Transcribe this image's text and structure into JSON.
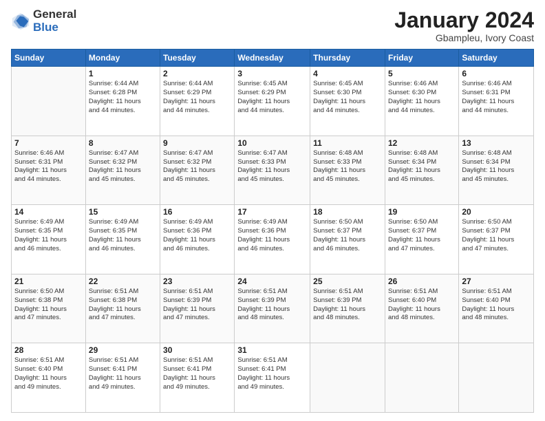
{
  "header": {
    "logo": {
      "general": "General",
      "blue": "Blue"
    },
    "title": "January 2024",
    "subtitle": "Gbampleu, Ivory Coast"
  },
  "calendar": {
    "days_of_week": [
      "Sunday",
      "Monday",
      "Tuesday",
      "Wednesday",
      "Thursday",
      "Friday",
      "Saturday"
    ],
    "weeks": [
      [
        {
          "num": "",
          "info": ""
        },
        {
          "num": "1",
          "info": "Sunrise: 6:44 AM\nSunset: 6:28 PM\nDaylight: 11 hours\nand 44 minutes."
        },
        {
          "num": "2",
          "info": "Sunrise: 6:44 AM\nSunset: 6:29 PM\nDaylight: 11 hours\nand 44 minutes."
        },
        {
          "num": "3",
          "info": "Sunrise: 6:45 AM\nSunset: 6:29 PM\nDaylight: 11 hours\nand 44 minutes."
        },
        {
          "num": "4",
          "info": "Sunrise: 6:45 AM\nSunset: 6:30 PM\nDaylight: 11 hours\nand 44 minutes."
        },
        {
          "num": "5",
          "info": "Sunrise: 6:46 AM\nSunset: 6:30 PM\nDaylight: 11 hours\nand 44 minutes."
        },
        {
          "num": "6",
          "info": "Sunrise: 6:46 AM\nSunset: 6:31 PM\nDaylight: 11 hours\nand 44 minutes."
        }
      ],
      [
        {
          "num": "7",
          "info": "Sunrise: 6:46 AM\nSunset: 6:31 PM\nDaylight: 11 hours\nand 44 minutes."
        },
        {
          "num": "8",
          "info": "Sunrise: 6:47 AM\nSunset: 6:32 PM\nDaylight: 11 hours\nand 45 minutes."
        },
        {
          "num": "9",
          "info": "Sunrise: 6:47 AM\nSunset: 6:32 PM\nDaylight: 11 hours\nand 45 minutes."
        },
        {
          "num": "10",
          "info": "Sunrise: 6:47 AM\nSunset: 6:33 PM\nDaylight: 11 hours\nand 45 minutes."
        },
        {
          "num": "11",
          "info": "Sunrise: 6:48 AM\nSunset: 6:33 PM\nDaylight: 11 hours\nand 45 minutes."
        },
        {
          "num": "12",
          "info": "Sunrise: 6:48 AM\nSunset: 6:34 PM\nDaylight: 11 hours\nand 45 minutes."
        },
        {
          "num": "13",
          "info": "Sunrise: 6:48 AM\nSunset: 6:34 PM\nDaylight: 11 hours\nand 45 minutes."
        }
      ],
      [
        {
          "num": "14",
          "info": "Sunrise: 6:49 AM\nSunset: 6:35 PM\nDaylight: 11 hours\nand 46 minutes."
        },
        {
          "num": "15",
          "info": "Sunrise: 6:49 AM\nSunset: 6:35 PM\nDaylight: 11 hours\nand 46 minutes."
        },
        {
          "num": "16",
          "info": "Sunrise: 6:49 AM\nSunset: 6:36 PM\nDaylight: 11 hours\nand 46 minutes."
        },
        {
          "num": "17",
          "info": "Sunrise: 6:49 AM\nSunset: 6:36 PM\nDaylight: 11 hours\nand 46 minutes."
        },
        {
          "num": "18",
          "info": "Sunrise: 6:50 AM\nSunset: 6:37 PM\nDaylight: 11 hours\nand 46 minutes."
        },
        {
          "num": "19",
          "info": "Sunrise: 6:50 AM\nSunset: 6:37 PM\nDaylight: 11 hours\nand 47 minutes."
        },
        {
          "num": "20",
          "info": "Sunrise: 6:50 AM\nSunset: 6:37 PM\nDaylight: 11 hours\nand 47 minutes."
        }
      ],
      [
        {
          "num": "21",
          "info": "Sunrise: 6:50 AM\nSunset: 6:38 PM\nDaylight: 11 hours\nand 47 minutes."
        },
        {
          "num": "22",
          "info": "Sunrise: 6:51 AM\nSunset: 6:38 PM\nDaylight: 11 hours\nand 47 minutes."
        },
        {
          "num": "23",
          "info": "Sunrise: 6:51 AM\nSunset: 6:39 PM\nDaylight: 11 hours\nand 47 minutes."
        },
        {
          "num": "24",
          "info": "Sunrise: 6:51 AM\nSunset: 6:39 PM\nDaylight: 11 hours\nand 48 minutes."
        },
        {
          "num": "25",
          "info": "Sunrise: 6:51 AM\nSunset: 6:39 PM\nDaylight: 11 hours\nand 48 minutes."
        },
        {
          "num": "26",
          "info": "Sunrise: 6:51 AM\nSunset: 6:40 PM\nDaylight: 11 hours\nand 48 minutes."
        },
        {
          "num": "27",
          "info": "Sunrise: 6:51 AM\nSunset: 6:40 PM\nDaylight: 11 hours\nand 48 minutes."
        }
      ],
      [
        {
          "num": "28",
          "info": "Sunrise: 6:51 AM\nSunset: 6:40 PM\nDaylight: 11 hours\nand 49 minutes."
        },
        {
          "num": "29",
          "info": "Sunrise: 6:51 AM\nSunset: 6:41 PM\nDaylight: 11 hours\nand 49 minutes."
        },
        {
          "num": "30",
          "info": "Sunrise: 6:51 AM\nSunset: 6:41 PM\nDaylight: 11 hours\nand 49 minutes."
        },
        {
          "num": "31",
          "info": "Sunrise: 6:51 AM\nSunset: 6:41 PM\nDaylight: 11 hours\nand 49 minutes."
        },
        {
          "num": "",
          "info": ""
        },
        {
          "num": "",
          "info": ""
        },
        {
          "num": "",
          "info": ""
        }
      ]
    ]
  }
}
